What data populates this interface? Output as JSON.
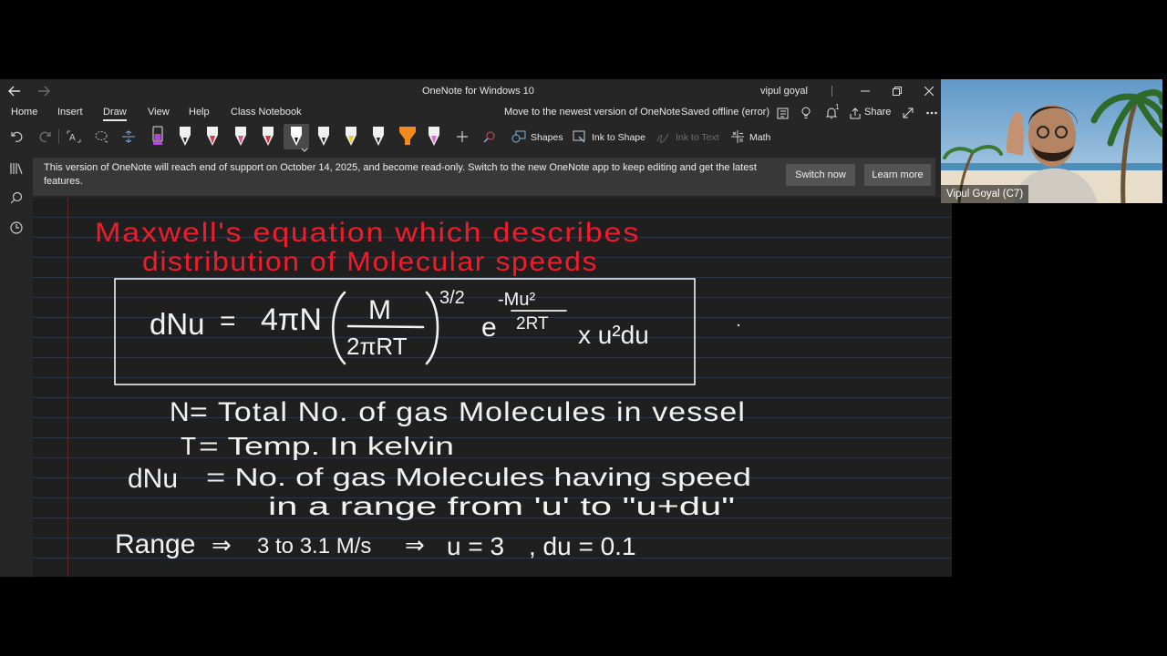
{
  "window": {
    "title": "OneNote for Windows 10",
    "user": "vipul goyal"
  },
  "menu": {
    "items": [
      "Home",
      "Insert",
      "Draw",
      "View",
      "Help",
      "Class Notebook"
    ],
    "active": "Draw",
    "upgrade_link": "Move to the newest version of OneNote",
    "sync_status": "Saved offline (error)",
    "notification_count": "1",
    "share_label": "Share"
  },
  "toolbar": {
    "shapes_label": "Shapes",
    "ink_to_shape_label": "Ink to Shape",
    "ink_to_text_label": "Ink to Text",
    "math_label": "Math",
    "pens": [
      {
        "name": "pen-purple",
        "color": "#b545d6"
      },
      {
        "name": "pen-white-1",
        "color": "#f0f0f0"
      },
      {
        "name": "pen-red-1",
        "color": "#e23b50"
      },
      {
        "name": "pen-pink",
        "color": "#e0508f"
      },
      {
        "name": "pen-red-2",
        "color": "#e0303a"
      },
      {
        "name": "pen-white-selected",
        "color": "#ffffff"
      },
      {
        "name": "pen-white-2",
        "color": "#f0f0f0"
      },
      {
        "name": "pen-yellow",
        "color": "#f2c81d"
      },
      {
        "name": "pen-white-3",
        "color": "#f0f0f0"
      },
      {
        "name": "highlighter-orange",
        "color": "#f08a1c"
      },
      {
        "name": "highlighter-magenta",
        "color": "#e66bd8"
      }
    ]
  },
  "banner": {
    "message": "This version of OneNote will reach end of support on October 14, 2025, and become read-only. Switch to the new OneNote app to keep editing and get the latest features.",
    "switch_now": "Switch now",
    "learn_more": "Learn more"
  },
  "notes": {
    "heading_line1": "Maxwell's equation which describes",
    "heading_line2": "distribution of Molecular speeds",
    "equation": {
      "lhs": "dNu",
      "eq": "=",
      "coef": "4πN",
      "num": "M",
      "den": "2πRT",
      "power": "3/2",
      "e": "e",
      "exp_num": "-Mu²",
      "exp_den": "2RT",
      "tail": "x u²du"
    },
    "def_n_symbol": "N",
    "def_n_text": "= Total No. of gas Molecules in vessel",
    "def_t_symbol": "T",
    "def_t_text": "= Temp. In kelvin",
    "def_dn_symbol": "dNu",
    "def_dn_text_line1": "= No. of gas Molecules having speed",
    "def_dn_text_line2": "in a range from 'u' to \"u+du\"",
    "range_label": "Range",
    "range_arrow": "⇒",
    "range_value": "3 to 3.1 M/s",
    "range_arrow2": "⇒",
    "range_u": "u = 3",
    "range_du": ", du = 0.1"
  },
  "camera": {
    "participant": "Vipul Goyal (C7)"
  }
}
